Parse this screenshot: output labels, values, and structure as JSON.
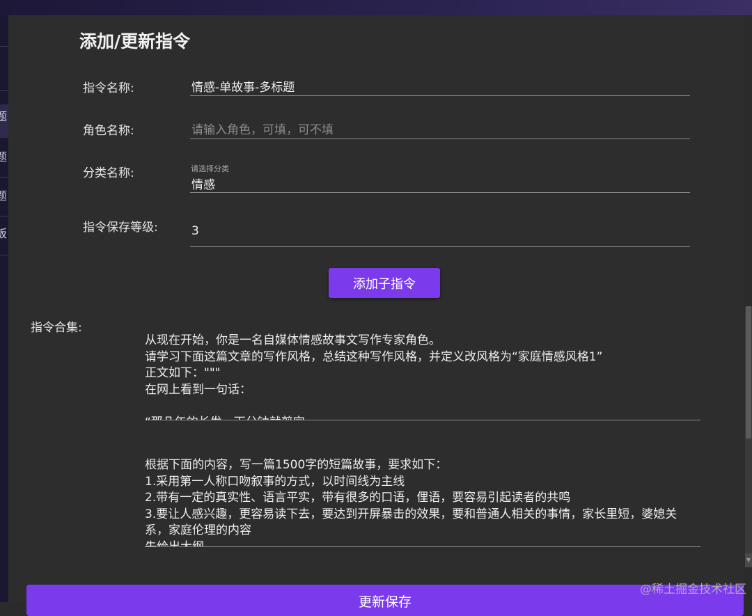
{
  "form": {
    "title": "添加/更新指令",
    "fields": [
      {
        "label": "指令名称:",
        "value": "情感-单故事-多标题",
        "placeholder": ""
      },
      {
        "label": "角色名称:",
        "value": "",
        "placeholder": "请输入角色，可填，可不填"
      },
      {
        "label": "分类名称:",
        "value": "情感",
        "placeholder": "请选择分类"
      },
      {
        "label": "指令保存等级:",
        "value": "3",
        "placeholder": ""
      }
    ],
    "add_sub_button": "添加子指令",
    "collection_label": "指令合集:",
    "sub_instructions": [
      {
        "lines": [
          "从现在开始，你是一名自媒体情感故事文写作专家角色。",
          "请学习下面这篇文章的写作风格，总结这种写作风格，并定义改风格为“家庭情感风格1”",
          "正文如下：\"\"\"",
          "在网上看到一句话：",
          "",
          "“那几年的长发，下分钟就剪完"
        ]
      },
      {
        "lines": [
          "根据下面的内容，写一篇1500字的短篇故事，要求如下：",
          "1.采用第一人称口吻叙事的方式，以时间线为主线",
          "2.带有一定的真实性、语言平实，带有很多的口语，俚语，要容易引起读者的共鸣",
          "3.要让人感兴趣，更容易读下去，要达到开屏暴击的效果，要和普通人相关的事情，家长里短，婆媳关系，家庭伦理的内容",
          "先给出大纲"
        ]
      }
    ],
    "save_button": "更新保存"
  },
  "sidebar": {
    "fragments": [
      "题",
      "题",
      "题",
      "板"
    ]
  },
  "watermark": "@稀土掘金技术社区",
  "colors": {
    "accent": "#7c3aed",
    "background": "#2d2d2d"
  }
}
